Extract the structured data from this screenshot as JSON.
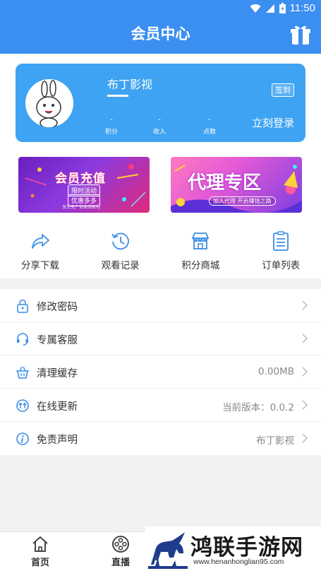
{
  "status_bar": {
    "time": "11:50"
  },
  "header": {
    "title": "会员中心"
  },
  "profile": {
    "name": "布丁影视",
    "sign_label": "签到",
    "login_label": "立刻登录",
    "stats": [
      {
        "value": "-",
        "label": "积分"
      },
      {
        "value": "-",
        "label": "收入"
      },
      {
        "value": "-",
        "label": "点数"
      }
    ]
  },
  "banners": {
    "recharge": {
      "title": "会员充值",
      "badge1": "限时活动",
      "badge2": "优惠多多",
      "footer": "享受无广告高清影视"
    },
    "agent": {
      "title": "代理专区",
      "subtitle": "加入代理 开启赚钱之路"
    }
  },
  "quick_nav": [
    {
      "label": "分享下载",
      "icon": "share-icon"
    },
    {
      "label": "观看记录",
      "icon": "history-icon"
    },
    {
      "label": "积分商城",
      "icon": "store-icon"
    },
    {
      "label": "订单列表",
      "icon": "clipboard-icon"
    }
  ],
  "menu": [
    {
      "label": "修改密码",
      "value": "",
      "icon": "lock-icon"
    },
    {
      "label": "专属客服",
      "value": "",
      "icon": "headset-icon"
    },
    {
      "label": "清理缓存",
      "value": "0.00MB",
      "icon": "basket-icon"
    },
    {
      "label": "在线更新",
      "value": "当前版本：0.0.2",
      "icon": "update-icon"
    },
    {
      "label": "免责声明",
      "value": "布丁影视",
      "icon": "info-icon"
    }
  ],
  "tabbar": [
    {
      "label": "首页",
      "icon": "home-icon"
    },
    {
      "label": "直播",
      "icon": "film-reel-icon"
    }
  ],
  "watermark": {
    "title": "鸿联手游网",
    "url": "www.henanhonglian95.com"
  },
  "colors": {
    "primary": "#3b8ff0",
    "card": "#3ea3f2",
    "icon": "#3a8ee6"
  }
}
